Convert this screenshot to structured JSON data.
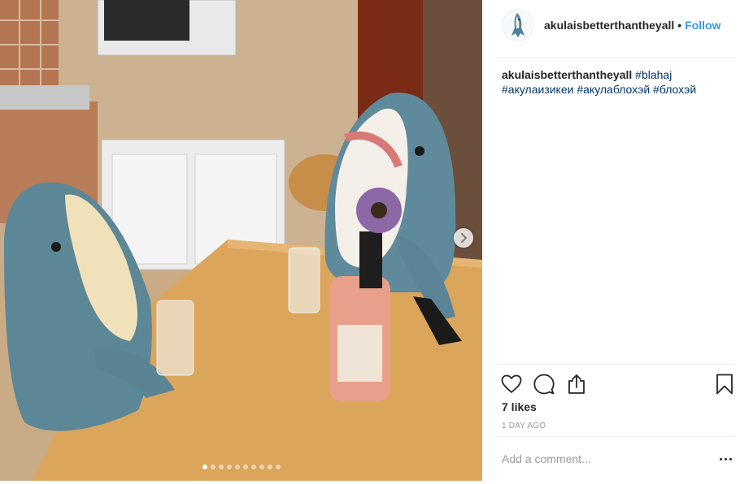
{
  "post": {
    "author": {
      "username": "akulaisbetterthantheyall",
      "avatar_icon": "shark-avatar-icon",
      "separator": "•",
      "follow_label": "Follow"
    },
    "caption": {
      "username": "akulaisbetterthantheyall",
      "tags": [
        "#blahaj",
        "#акулаизикеи",
        "#акулаблохэй",
        "#блохэй"
      ]
    },
    "media": {
      "carousel_count": 10,
      "current_index": 1,
      "next_icon": "chevron-right-icon"
    },
    "actions": {
      "like_icon": "heart-icon",
      "comment_icon": "comment-icon",
      "share_icon": "share-icon",
      "save_icon": "bookmark-icon"
    },
    "likes_text": "7 likes",
    "timestamp": "1 DAY AGO",
    "comment_placeholder": "Add a comment...",
    "more_icon": "more-options-icon"
  },
  "colors": {
    "link_blue": "#3897f0",
    "hashtag_blue": "#003569",
    "muted": "#999999",
    "text": "#262626",
    "divider": "#efefef"
  }
}
